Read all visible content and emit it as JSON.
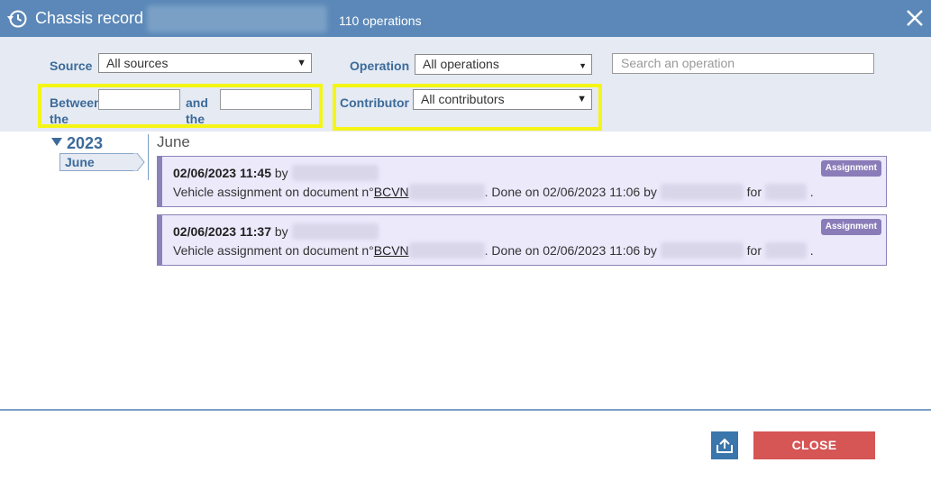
{
  "window": {
    "title": "Chassis record",
    "operation_count": "110 operations",
    "icon": "history-icon",
    "close_icon": "close-icon",
    "header_color": "#5b88b8"
  },
  "filters": {
    "source_label": "Source",
    "source_value": "All sources",
    "operation_label": "Operation",
    "operation_value": "All operations",
    "search_placeholder": "Search an operation",
    "between_label": "Between the",
    "and_label": "and the",
    "between_value": "",
    "and_value": "",
    "contributor_label": "Contributor",
    "contributor_value": "All contributors",
    "highlight_color": "#f5f516"
  },
  "timeline": {
    "year": "2023",
    "month": "June",
    "month_heading": "June"
  },
  "operations": [
    {
      "datetime": "02/06/2023 11:45",
      "by": "by",
      "text_prefix": "Vehicle assignment on document n°",
      "doc_ref": "BCVN",
      "done_text": ". Done on 02/06/2023 11:06 by",
      "for_text": "for",
      "end_text": ".",
      "badge": "Assignment"
    },
    {
      "datetime": "02/06/2023 11:37",
      "by": "by",
      "text_prefix": "Vehicle assignment on document n°",
      "doc_ref": "BCVN",
      "done_text": ". Done on 02/06/2023 11:06 by",
      "for_text": "for",
      "end_text": ".",
      "badge": "Assignment"
    }
  ],
  "footer": {
    "export_icon": "export-icon",
    "close_label": "CLOSE",
    "close_color": "#d65555",
    "export_color": "#3a76ab"
  }
}
